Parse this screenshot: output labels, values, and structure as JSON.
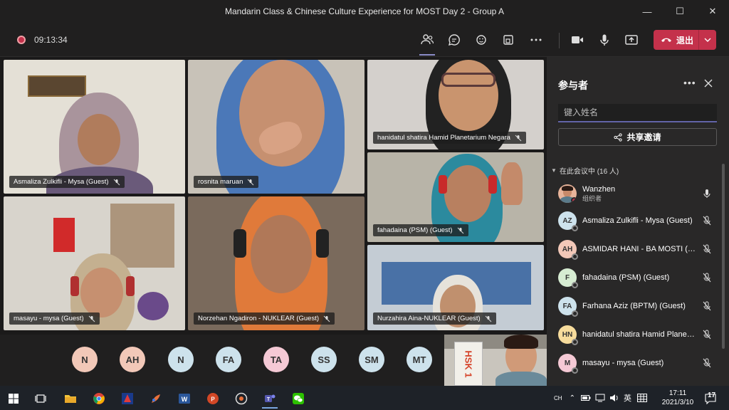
{
  "window": {
    "title": "Mandarin Class & Chinese Culture Experience for MOST Day 2 - Group A",
    "minimize": "—",
    "maximize": "☐",
    "close": "✕"
  },
  "toolbar": {
    "timer": "09:13:34",
    "leave_label": "退出",
    "icons": [
      "participants-icon",
      "chat-icon",
      "reactions-icon",
      "rooms-icon",
      "more-icon",
      "camera-icon",
      "mic-icon",
      "share-icon"
    ]
  },
  "tiles": [
    {
      "name": "Asmaliza Zulkifli - Mysa (Guest)"
    },
    {
      "name": "rosnita maruan"
    },
    {
      "name": "hanidatul shatira Hamid Planetarium Negara"
    },
    {
      "name": "fahadaina (PSM) (Guest)"
    },
    {
      "name": "masayu - mysa (Guest)"
    },
    {
      "name": "Norzehan Ngadiron - NUKLEAR (Guest)"
    },
    {
      "name": "Nurzahira Aina-NUKLEAR (Guest)"
    }
  ],
  "avatars": [
    {
      "initials": "N",
      "color": "#f2c8b8"
    },
    {
      "initials": "AH",
      "color": "#f2c8b8"
    },
    {
      "initials": "N",
      "color": "#cde2ec"
    },
    {
      "initials": "FA",
      "color": "#cde2ec"
    },
    {
      "initials": "TA",
      "color": "#f5c9d5"
    },
    {
      "initials": "SS",
      "color": "#cde2ec"
    },
    {
      "initials": "SM",
      "color": "#cde2ec"
    },
    {
      "initials": "MT",
      "color": "#cde2ec"
    }
  ],
  "self_view": {
    "book_text": "HSK 1"
  },
  "panel": {
    "title": "参与者",
    "more": "•••",
    "search_placeholder": "键入姓名",
    "share_label": "共享邀请",
    "section_label": "在此会议中 (16 人)",
    "participants": [
      {
        "initials": "",
        "name": "Wanzhen",
        "role": "组织者",
        "color": "#e8b49a",
        "mic": "on"
      },
      {
        "initials": "AZ",
        "name": "Asmaliza Zulkifli - Mysa (Guest)",
        "role": "",
        "color": "#cde2ec",
        "mic": "off"
      },
      {
        "initials": "AH",
        "name": "ASMIDAR HANI - BA MOSTI (Guest)",
        "role": "",
        "color": "#f2c8b8",
        "mic": "off"
      },
      {
        "initials": "F",
        "name": "fahadaina (PSM) (Guest)",
        "role": "",
        "color": "#d6ecd2",
        "mic": "off"
      },
      {
        "initials": "FA",
        "name": "Farhana Aziz (BPTM) (Guest)",
        "role": "",
        "color": "#cde2ec",
        "mic": "off"
      },
      {
        "initials": "HN",
        "name": "hanidatul shatira Hamid Planetarium Negara",
        "role": "",
        "color": "#f7dc9c",
        "mic": "off"
      },
      {
        "initials": "M",
        "name": "masayu - mysa (Guest)",
        "role": "",
        "color": "#f5c9d5",
        "mic": "off"
      }
    ]
  },
  "taskbar": {
    "time": "17:11",
    "date": "2021/3/10",
    "ime": "英",
    "notifications": "17",
    "apps": [
      "start-icon",
      "task-view-icon",
      "file-explorer-icon",
      "chrome-icon",
      "app-blue-icon",
      "paint-icon",
      "word-icon",
      "powerpoint-icon",
      "media-icon",
      "teams-icon",
      "wechat-icon"
    ]
  },
  "colors": {
    "accent": "#6264a7",
    "leave": "#c4314b",
    "panel_bg": "#292828",
    "app_bg": "#201f1f"
  }
}
